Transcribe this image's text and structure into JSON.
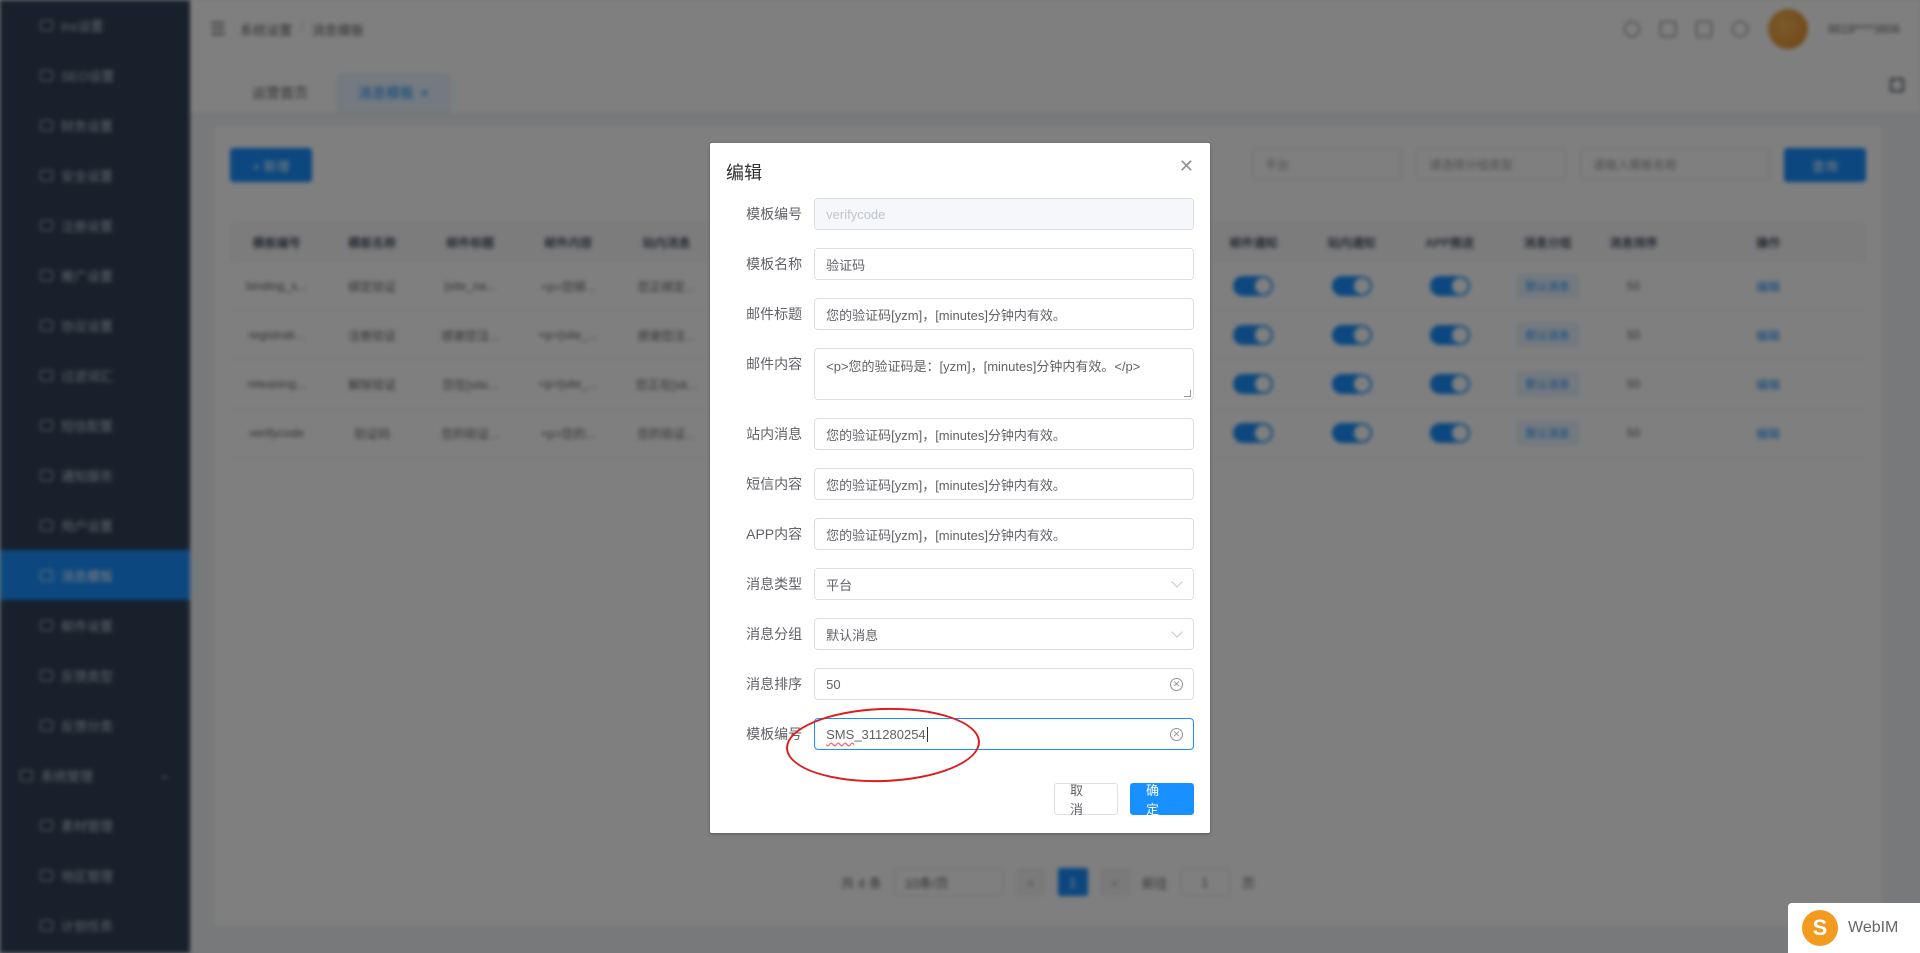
{
  "sidebar": {
    "items": [
      {
        "label": "ins设置"
      },
      {
        "label": "SEO设置"
      },
      {
        "label": "财务设置"
      },
      {
        "label": "安全设置"
      },
      {
        "label": "注册设置"
      },
      {
        "label": "推广设置"
      },
      {
        "label": "协议设置"
      },
      {
        "label": "过滤词汇"
      },
      {
        "label": "短信配置"
      },
      {
        "label": "通知服务"
      },
      {
        "label": "用户设置"
      },
      {
        "label": "消息模板"
      },
      {
        "label": "邮件设置"
      },
      {
        "label": "反馈类型"
      },
      {
        "label": "反馈分类"
      }
    ],
    "group_label": "系统管理",
    "sub_items": [
      {
        "label": "素材管理"
      },
      {
        "label": "地区管理"
      },
      {
        "label": "计划任务"
      }
    ]
  },
  "topbar": {
    "breadcrumb": [
      "系统设置",
      "消息模板"
    ],
    "user_name": "8618****3806"
  },
  "tabs": [
    {
      "label": "运营首页"
    },
    {
      "label": "消息模板"
    }
  ],
  "toolbar": {
    "add_label": "+ 新增",
    "filter_type": "平台",
    "filter_group": "请选择分组类型",
    "filter_name_placeholder": "请输入模板名称",
    "query_label": "查询"
  },
  "table": {
    "headers": [
      "模板编号",
      "模板名称",
      "邮件标题",
      "邮件内容",
      "站内消息",
      "邮件通知",
      "站内通知",
      "APP推送",
      "消息分组",
      "消息排序",
      "操作"
    ],
    "rows": [
      {
        "code": "binding_s...",
        "name": "绑定验证",
        "mail_title": "[site_na...",
        "mail_body": "<p>您绑...",
        "site": "您正绑定...",
        "group": "默认消息",
        "sort": "50",
        "op": "编辑"
      },
      {
        "code": "registrati...",
        "name": "注册验证",
        "mail_title": "感谢您注...",
        "mail_body": "<p>[site_...",
        "site": "感谢您注...",
        "group": "默认消息",
        "sort": "50",
        "op": "编辑"
      },
      {
        "code": "releasing...",
        "name": "解除验证",
        "mail_title": "您在[site...",
        "mail_body": "<p>[site_...",
        "site": "您正在[sit...",
        "group": "默认消息",
        "sort": "50",
        "op": "编辑"
      },
      {
        "code": "verifycode",
        "name": "验证码",
        "mail_title": "您的验证...",
        "mail_body": "<p>您的...",
        "site": "您的验证...",
        "group": "默认消息",
        "sort": "50",
        "op": "编辑"
      }
    ]
  },
  "pager": {
    "total": "共 4 条",
    "page_size": "10条/页",
    "current": "1",
    "goto_label": "前往",
    "goto_value": "1",
    "page_unit": "页"
  },
  "dialog": {
    "title": "编辑",
    "fields": [
      {
        "label": "模板编号",
        "value": "verifycode"
      },
      {
        "label": "模板名称",
        "value": "验证码"
      },
      {
        "label": "邮件标题",
        "value": "您的验证码[yzm]，[minutes]分钟内有效。"
      },
      {
        "label": "邮件内容",
        "value": "<p>您的验证码是：[yzm]，[minutes]分钟内有效。</p>"
      },
      {
        "label": "站内消息",
        "value": "您的验证码[yzm]，[minutes]分钟内有效。"
      },
      {
        "label": "短信内容",
        "value": "您的验证码[yzm]，[minutes]分钟内有效。"
      },
      {
        "label": "APP内容",
        "value": "您的验证码[yzm]，[minutes]分钟内有效。"
      },
      {
        "label": "消息类型",
        "value": "平台"
      },
      {
        "label": "消息分组",
        "value": "默认消息"
      },
      {
        "label": "消息排序",
        "value": "50"
      },
      {
        "label": "模板编号",
        "value_prefix": "SMS",
        "value_suffix": "_311280254"
      }
    ],
    "cancel_label": "取 消",
    "confirm_label": "确 定"
  },
  "webim": {
    "label": "WebIM",
    "logo": "S"
  }
}
